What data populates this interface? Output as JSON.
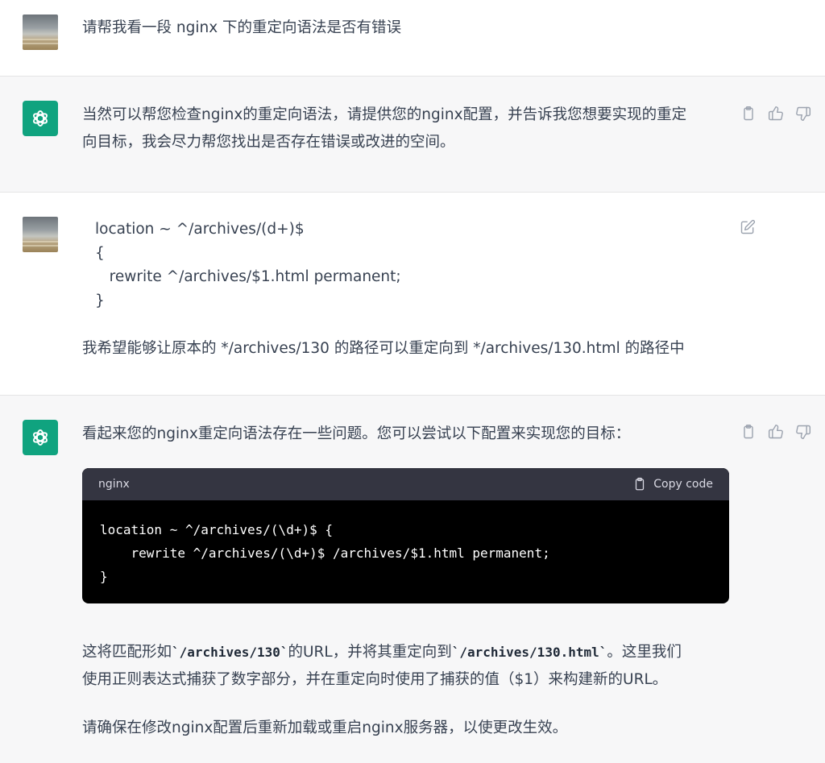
{
  "conversation": [
    {
      "role": "user",
      "text": "请帮我看一段 nginx 下的重定向语法是否有错误"
    },
    {
      "role": "assistant",
      "lines": [
        "当然可以帮您检查nginx的重定向语法，请提供您的nginx配置，并告诉我您想要实现的重定",
        "向目标，我会尽力帮您找出是否存在错误或改进的空间。"
      ]
    },
    {
      "role": "user",
      "config_lines": [
        "location ~ ^/archives/(d+)$",
        "{",
        "   rewrite ^/archives/$1.html permanent;",
        "}"
      ],
      "request": "我希望能够让原本的 */archives/130 的路径可以重定向到 */archives/130.html 的路径中"
    },
    {
      "role": "assistant",
      "intro": "看起来您的nginx重定向语法存在一些问题。您可以尝试以下配置来实现您的目标：",
      "code": {
        "language": "nginx",
        "copy_label": "Copy code",
        "lines": [
          "location ~ ^/archives/(\\d+)$ {",
          "    rewrite ^/archives/(\\d+)$ /archives/$1.html permanent;",
          "}"
        ]
      },
      "explain": {
        "p1_a": "这将匹配形如",
        "p1_code1": "`/archives/130`",
        "p1_b": "的URL，并将其重定向到",
        "p1_code2": "`/archives/130.html`",
        "p1_c": "。这里我们",
        "p1_line2": "使用正则表达式捕获了数字部分，并在重定向时使用了捕获的值（$1）来构建新的URL。",
        "p2": "请确保在修改nginx配置后重新加载或重启nginx服务器，以使更改生效。"
      }
    }
  ],
  "icons": {
    "bot_avatar": "openai-logo-icon",
    "copy": "clipboard-icon",
    "thumb_up": "thumbs-up-icon",
    "thumb_down": "thumbs-down-icon",
    "edit": "edit-icon"
  },
  "colors": {
    "bot_avatar_bg": "#10a37f",
    "bot_row_bg": "#f7f7f8",
    "code_header_bg": "#343541",
    "code_body_bg": "#000000"
  }
}
